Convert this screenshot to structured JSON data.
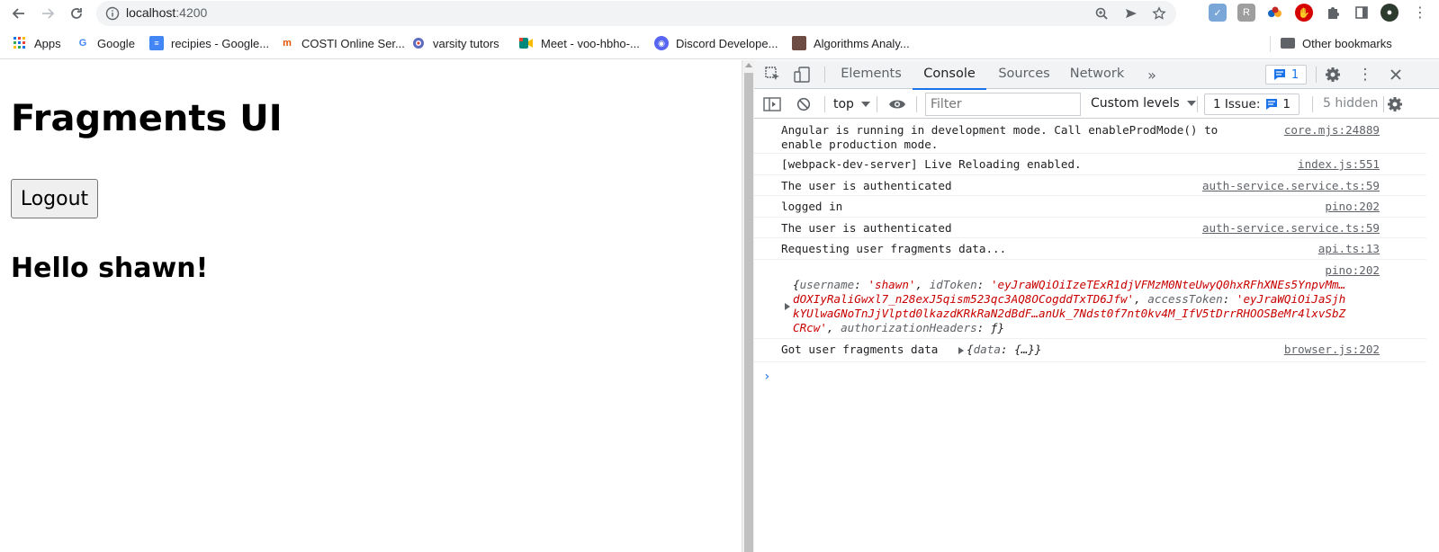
{
  "browser": {
    "url_host": "localhost",
    "url_port": ":4200",
    "back_icon": "arrow-left-icon",
    "forward_icon": "arrow-right-icon",
    "reload_icon": "reload-icon"
  },
  "bookmarks": {
    "items": [
      {
        "label": "Apps",
        "icon": "apps-grid-icon"
      },
      {
        "label": "Google",
        "icon": "google-g-icon"
      },
      {
        "label": "recipies - Google...",
        "icon": "google-docs-icon"
      },
      {
        "label": "COSTI Online Ser...",
        "icon": "costi-icon"
      },
      {
        "label": "varsity tutors",
        "icon": "varsity-tutors-icon"
      },
      {
        "label": "Meet - voo-hbho-...",
        "icon": "google-meet-icon"
      },
      {
        "label": "Discord Develope...",
        "icon": "discord-icon"
      },
      {
        "label": "Algorithms Analy...",
        "icon": "book-thumbnail-icon"
      }
    ],
    "other": "Other bookmarks"
  },
  "page": {
    "title": "Fragments UI",
    "logout_label": "Logout",
    "greeting": "Hello shawn!"
  },
  "devtools": {
    "tabs": [
      "Elements",
      "Console",
      "Sources",
      "Network"
    ],
    "active_tab": "Console",
    "message_count": "1",
    "context": "top",
    "filter_placeholder": "Filter",
    "levels": "Custom levels",
    "issue_label": "1 Issue:",
    "issue_count": "1",
    "hidden": "5 hidden",
    "accent": "#1a73e8",
    "string_color": "#c80000"
  },
  "console": {
    "rows": [
      {
        "msg": "Angular is running in development mode. Call enableProdMode() to\nenable production mode.",
        "src": "core.mjs:24889"
      },
      {
        "msg": "[webpack-dev-server] Live Reloading enabled.",
        "src": "index.js:551"
      },
      {
        "msg": "The user is authenticated",
        "src": "auth-service.service.ts:59"
      },
      {
        "msg": "logged in",
        "src": "pino:202"
      },
      {
        "msg": "The user is authenticated",
        "src": "auth-service.service.ts:59"
      },
      {
        "msg": "Requesting user fragments data...",
        "src": "api.ts:13"
      }
    ],
    "object_row": {
      "src": "pino:202",
      "k_username": "username",
      "v_username": "'shawn'",
      "k_idtoken": "idToken",
      "v_idtoken_1": "'eyJraWQiOiIzeTExR1djVFMzM0NteUwyQ0hxRFhXNEs5YnpvMm…",
      "v_idtoken_2": "dOXIyRaliGwxl7_n28exJ5qism523qc3AQ8OCogddTxTD6Jfw'",
      "k_accesstoken": "accessToken",
      "v_accesstoken_1": "'eyJraWQiOiJaSjh",
      "v_accesstoken_2": "kYUlwaGNoTnJjVlptd0lkazdKRkRaN2dBdF…anUk_7Ndst0f7nt0kv4M_IfV5tDrrRHOOSBeMr4lxvSbZ",
      "v_accesstoken_3": "CRcw'",
      "k_authheaders": "authorizationHeaders",
      "v_authheaders": "ƒ"
    },
    "data_row": {
      "msg": "Got user fragments data ",
      "obj_key": "data",
      "obj_val": "{…}",
      "src": "browser.js:202"
    }
  }
}
